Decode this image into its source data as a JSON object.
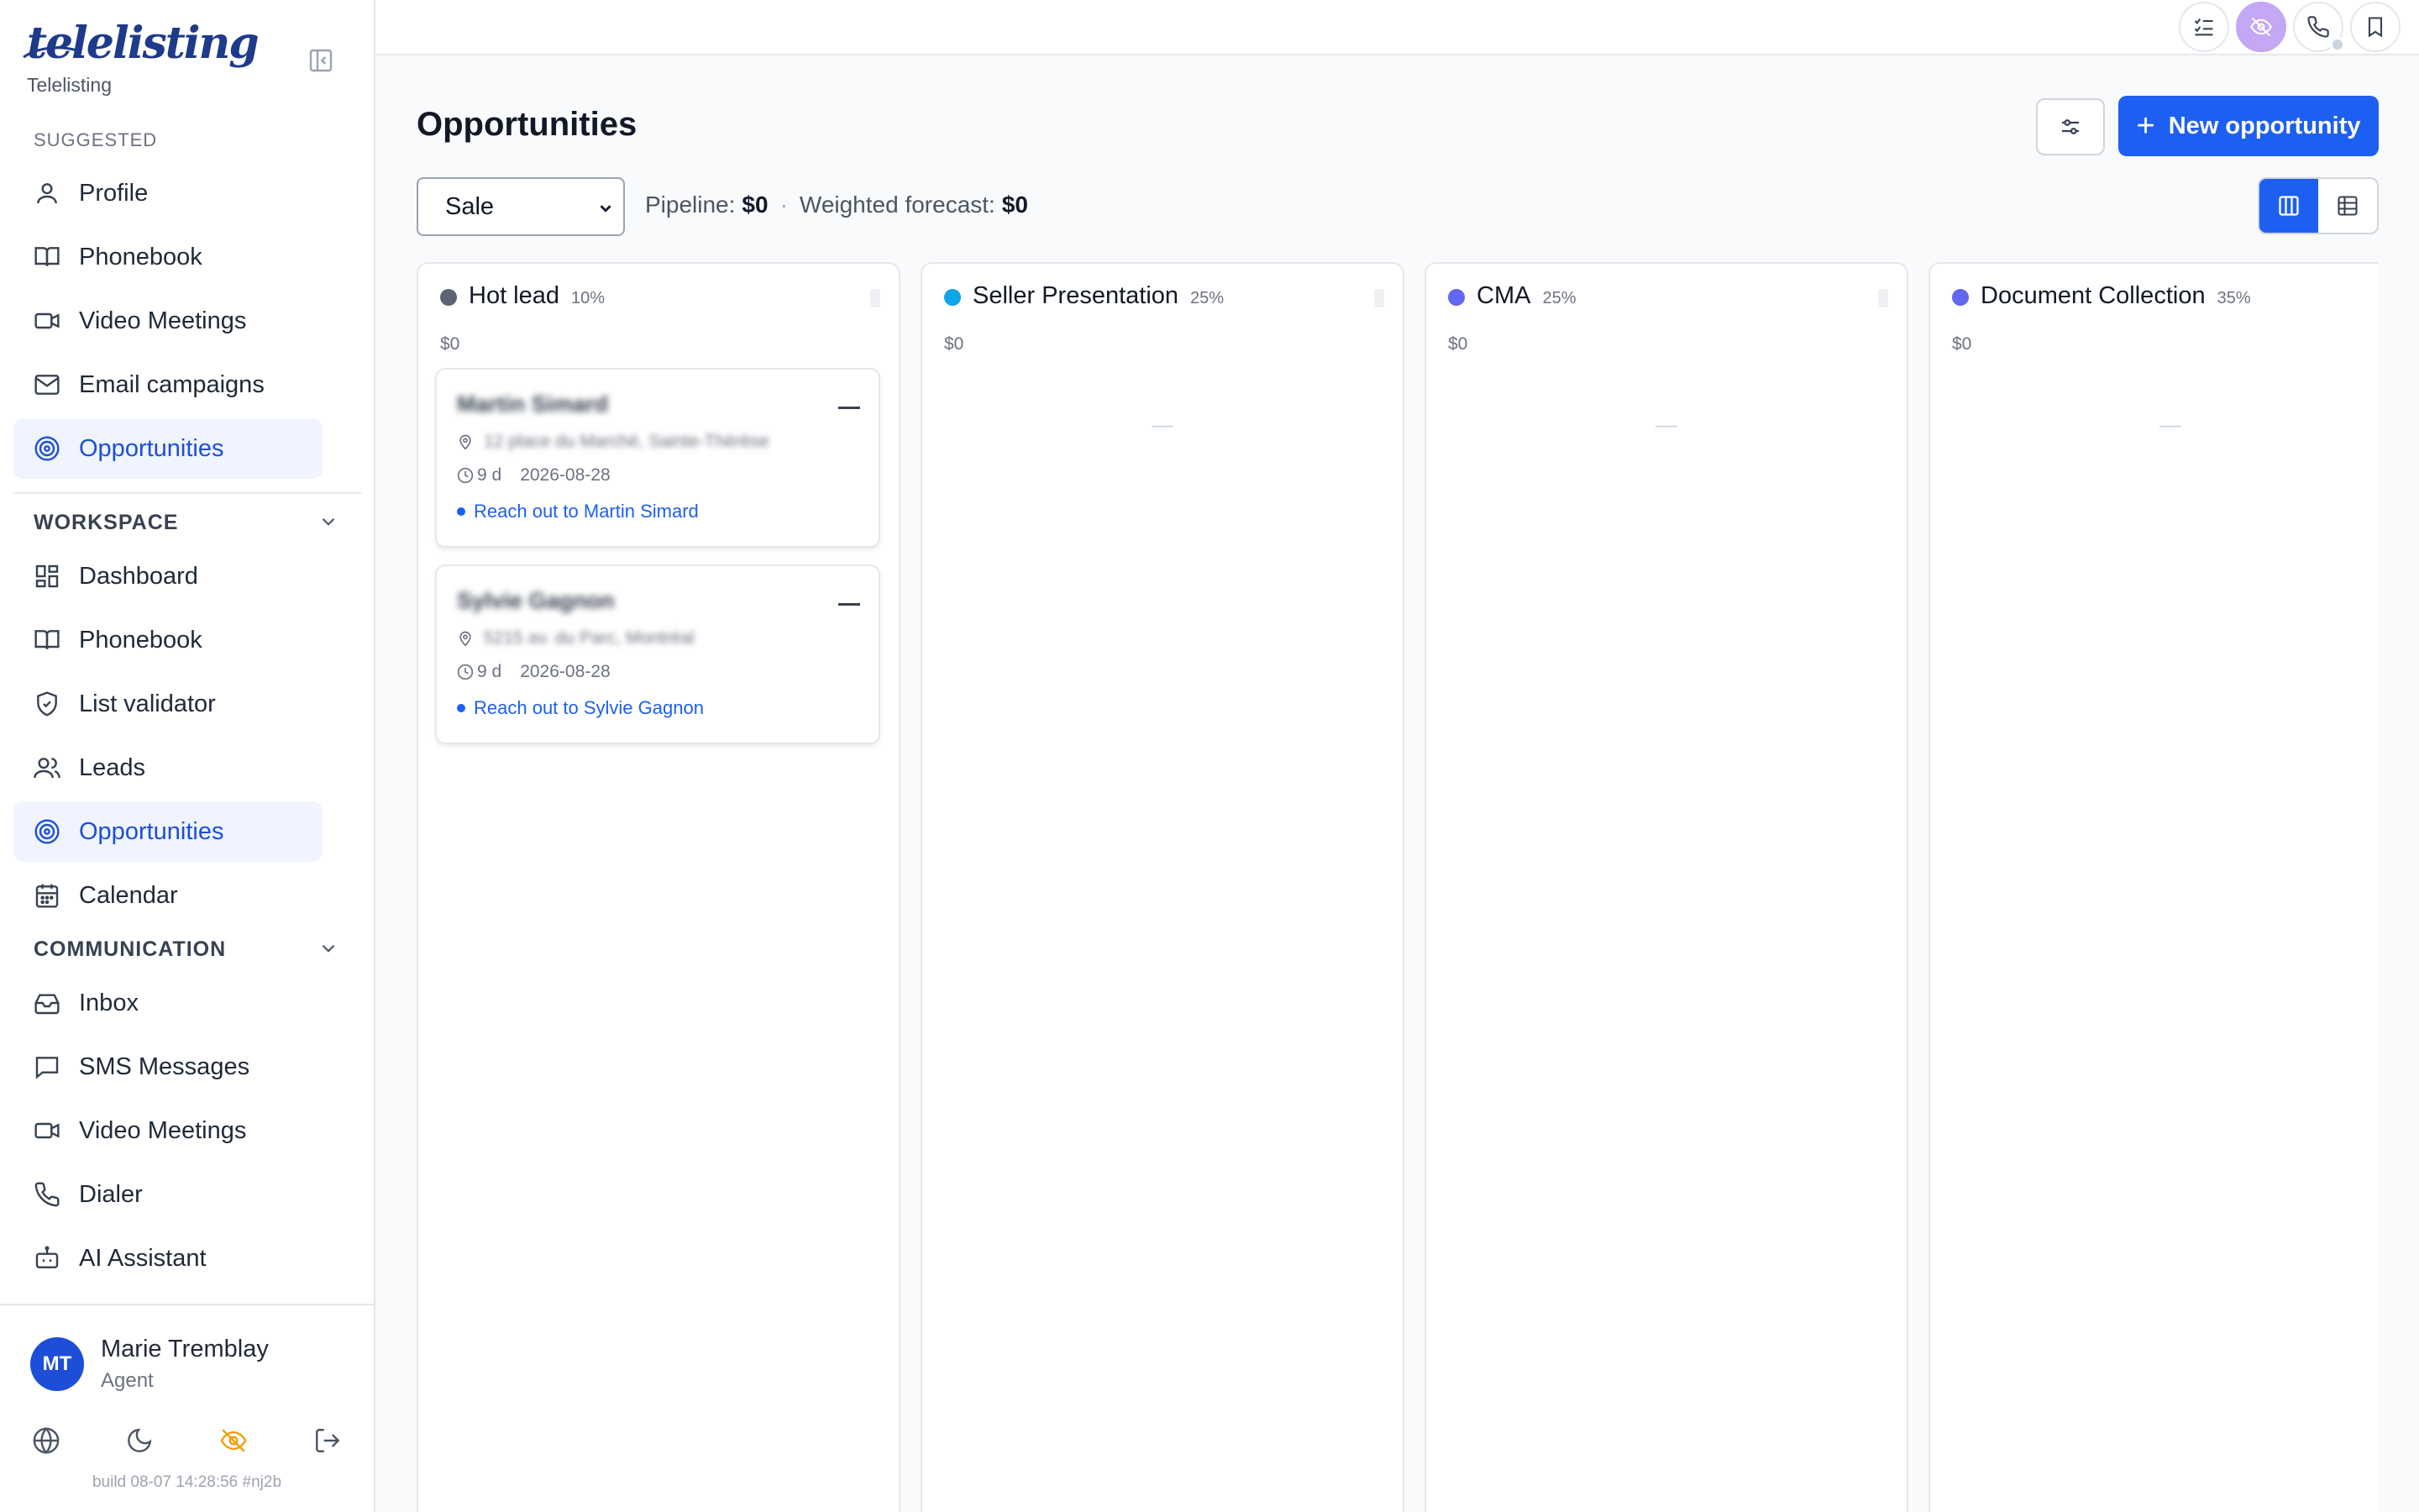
{
  "brand": {
    "logo_text": "telelisting",
    "subtitle": "Telelisting"
  },
  "sidebar": {
    "suggested_title": "SUGGESTED",
    "suggested_items": [
      {
        "label": "Profile",
        "icon": "user-icon"
      },
      {
        "label": "Phonebook",
        "icon": "book-icon"
      },
      {
        "label": "Video Meetings",
        "icon": "video-icon"
      },
      {
        "label": "Email campaigns",
        "icon": "mail-icon"
      },
      {
        "label": "Opportunities",
        "icon": "target-icon",
        "active": true
      }
    ],
    "workspace_title": "WORKSPACE",
    "workspace_items": [
      {
        "label": "Dashboard",
        "icon": "dashboard-icon"
      },
      {
        "label": "Phonebook",
        "icon": "book-icon"
      },
      {
        "label": "List validator",
        "icon": "shield-check-icon"
      },
      {
        "label": "Leads",
        "icon": "users-icon"
      },
      {
        "label": "Opportunities",
        "icon": "target-icon",
        "active": true
      },
      {
        "label": "Calendar",
        "icon": "calendar-icon"
      }
    ],
    "communication_title": "COMMUNICATION",
    "communication_items": [
      {
        "label": "Inbox",
        "icon": "inbox-icon"
      },
      {
        "label": "SMS Messages",
        "icon": "message-icon"
      },
      {
        "label": "Video Meetings",
        "icon": "video-icon"
      },
      {
        "label": "Dialer",
        "icon": "phone-icon"
      },
      {
        "label": "AI Assistant",
        "icon": "bot-icon"
      }
    ]
  },
  "user": {
    "initials": "MT",
    "name": "Marie Tremblay",
    "role": "Agent",
    "build": "build 08-07 14:28:56 #nj2b"
  },
  "topbar": {
    "icons": [
      "checklist-icon",
      "eye-off-icon",
      "phone-icon",
      "bookmark-icon"
    ],
    "accent_color": "#c4a7f5"
  },
  "main": {
    "title": "Opportunities",
    "new_button_label": "New opportunity",
    "pipeline_select": "Sale",
    "pipeline_label": "Pipeline:",
    "pipeline_value": "$0",
    "forecast_label": "Weighted forecast:",
    "forecast_value": "$0",
    "view_mode": "board"
  },
  "columns": [
    {
      "name": "Hot lead",
      "pct": "10%",
      "value": "$0",
      "color": "#5b6472",
      "cards": [
        {
          "name": "Martin Simard",
          "address": "12 place du Marché, Sainte-Thérèse",
          "age": "9 d",
          "date": "2026-08-28",
          "task": "Reach out to Martin Simard"
        },
        {
          "name": "Sylvie Gagnon",
          "address": "5215 av. du Parc, Montréal",
          "age": "9 d",
          "date": "2026-08-28",
          "task": "Reach out to Sylvie Gagnon"
        }
      ]
    },
    {
      "name": "Seller Presentation",
      "pct": "25%",
      "value": "$0",
      "color": "#0ea5e9",
      "empty": "—"
    },
    {
      "name": "CMA",
      "pct": "25%",
      "value": "$0",
      "color": "#6366f1",
      "empty": "—"
    },
    {
      "name": "Document Collection",
      "pct": "35%",
      "value": "$0",
      "color": "#6366f1",
      "empty": "—"
    }
  ],
  "colors": {
    "primary": "#1d5ff0",
    "active_bg": "#eff4ff",
    "active_text": "#1d4ed8"
  }
}
